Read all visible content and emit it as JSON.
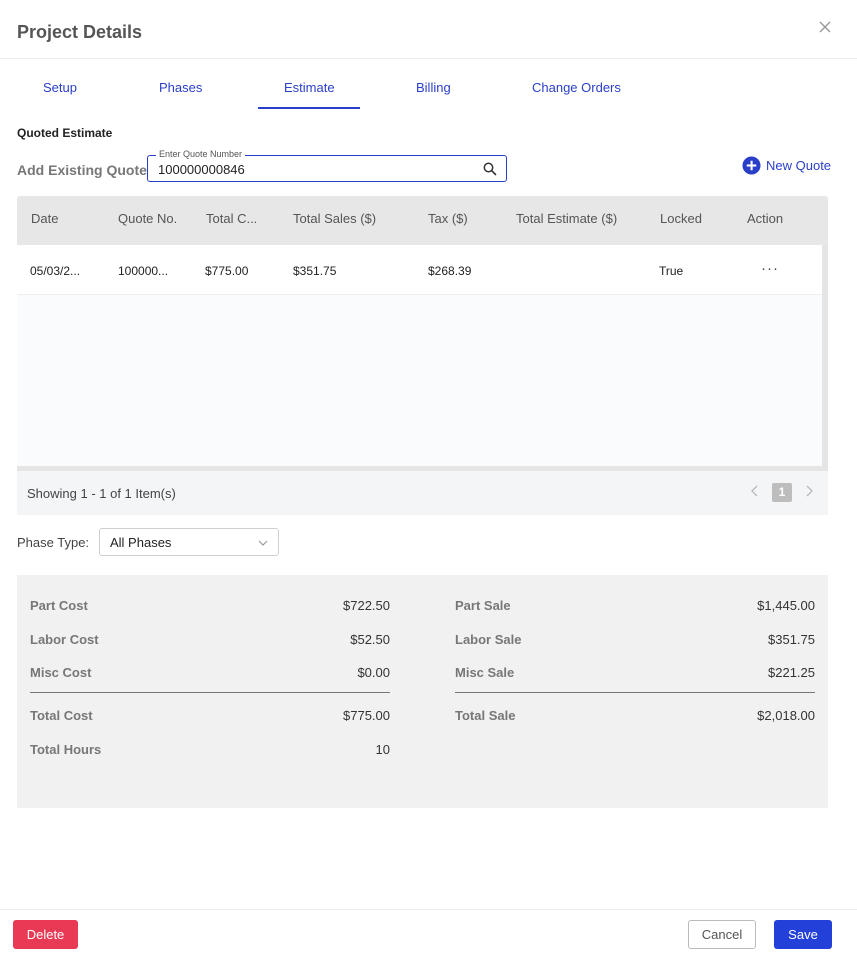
{
  "dialog": {
    "title": "Project Details",
    "close_icon": "close-icon"
  },
  "tabs": [
    {
      "label": "Setup",
      "active": false
    },
    {
      "label": "Phases",
      "active": false
    },
    {
      "label": "Estimate",
      "active": true
    },
    {
      "label": "Billing",
      "active": false
    },
    {
      "label": "Change Orders",
      "active": false
    }
  ],
  "quoted_estimate": {
    "section_title": "Quoted Estimate",
    "add_existing_label": "Add Existing Quote:",
    "quote_field_label": "Enter Quote Number",
    "quote_field_value": "100000000846",
    "new_quote_label": "New Quote"
  },
  "grid": {
    "columns": [
      "Date",
      "Quote No.",
      "Total C...",
      "Total Sales ($)",
      "Tax ($)",
      "Total Estimate ($)",
      "Locked",
      "Action"
    ],
    "rows": [
      {
        "date": "05/03/2...",
        "quote_no": "100000...",
        "total_cost": "$775.00",
        "total_sales": "$351.75",
        "tax": "$268.39",
        "total_estimate": "",
        "locked": "True",
        "action": "···"
      }
    ],
    "pager_text": "Showing 1 - 1 of 1 Item(s)",
    "current_page": "1"
  },
  "phase_type": {
    "label": "Phase Type:",
    "value": "All Phases"
  },
  "summary": {
    "left": [
      {
        "label": "Part Cost",
        "value": "$722.50"
      },
      {
        "label": "Labor Cost",
        "value": "$52.50"
      },
      {
        "label": "Misc Cost",
        "value": "$0.00"
      },
      {
        "label": "Total Cost",
        "value": "$775.00"
      },
      {
        "label": "Total Hours",
        "value": "10"
      }
    ],
    "right": [
      {
        "label": "Part Sale",
        "value": "$1,445.00"
      },
      {
        "label": "Labor Sale",
        "value": "$351.75"
      },
      {
        "label": "Misc Sale",
        "value": "$221.25"
      },
      {
        "label": "Total Sale",
        "value": "$2,018.00"
      }
    ]
  },
  "footer": {
    "delete_label": "Delete",
    "cancel_label": "Cancel",
    "save_label": "Save"
  },
  "colors": {
    "accent": "#2a3fc9",
    "danger": "#e93a55",
    "primary": "#2340d8"
  }
}
